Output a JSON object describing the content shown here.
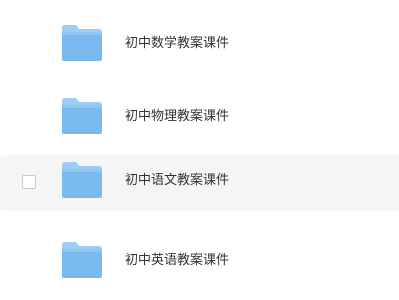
{
  "colors": {
    "folder_front": "#7ab9ee",
    "folder_back": "#9dcdf6",
    "text": "#333333",
    "row_hover_bg": "#f5f5f5"
  },
  "file_list": {
    "items": [
      {
        "name": "初中数学教案课件",
        "icon": "folder-icon",
        "hovered": false
      },
      {
        "name": "初中物理教案课件",
        "icon": "folder-icon",
        "hovered": false
      },
      {
        "name": "初中语文教案课件",
        "icon": "folder-icon",
        "hovered": true,
        "checked": false
      },
      {
        "name": "初中英语教案课件",
        "icon": "folder-icon",
        "hovered": false
      }
    ]
  }
}
